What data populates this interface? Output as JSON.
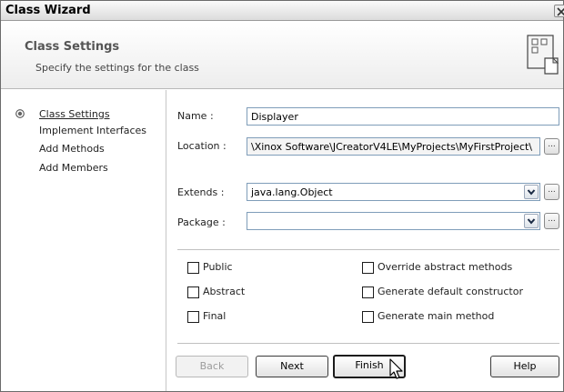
{
  "window": {
    "title": "Class Wizard"
  },
  "header": {
    "title": "Class Settings",
    "subtitle": "Specify the settings for the class"
  },
  "sidebar": {
    "items": [
      {
        "label": "Class Settings",
        "current": true
      },
      {
        "label": "Implement Interfaces",
        "current": false
      },
      {
        "label": "Add Methods",
        "current": false
      },
      {
        "label": "Add Members",
        "current": false
      }
    ]
  },
  "form": {
    "name_label": "Name :",
    "name_value": "Displayer",
    "location_label": "Location :",
    "location_value": "\\Xinox Software\\JCreatorV4LE\\MyProjects\\MyFirstProject\\",
    "extends_label": "Extends :",
    "extends_value": "java.lang.Object",
    "package_label": "Package :",
    "package_value": "",
    "browse_label": "..."
  },
  "options": {
    "public": {
      "label": "Public",
      "checked": false
    },
    "abstract": {
      "label": "Abstract",
      "checked": false
    },
    "final": {
      "label": "Final",
      "checked": false
    },
    "override_abstract": {
      "label": "Override abstract methods",
      "checked": false
    },
    "default_constructor": {
      "label": "Generate default constructor",
      "checked": false
    },
    "main_method": {
      "label": "Generate main method",
      "checked": false
    }
  },
  "buttons": {
    "back": "Back",
    "next": "Next",
    "finish": "Finish",
    "help": "Help"
  }
}
